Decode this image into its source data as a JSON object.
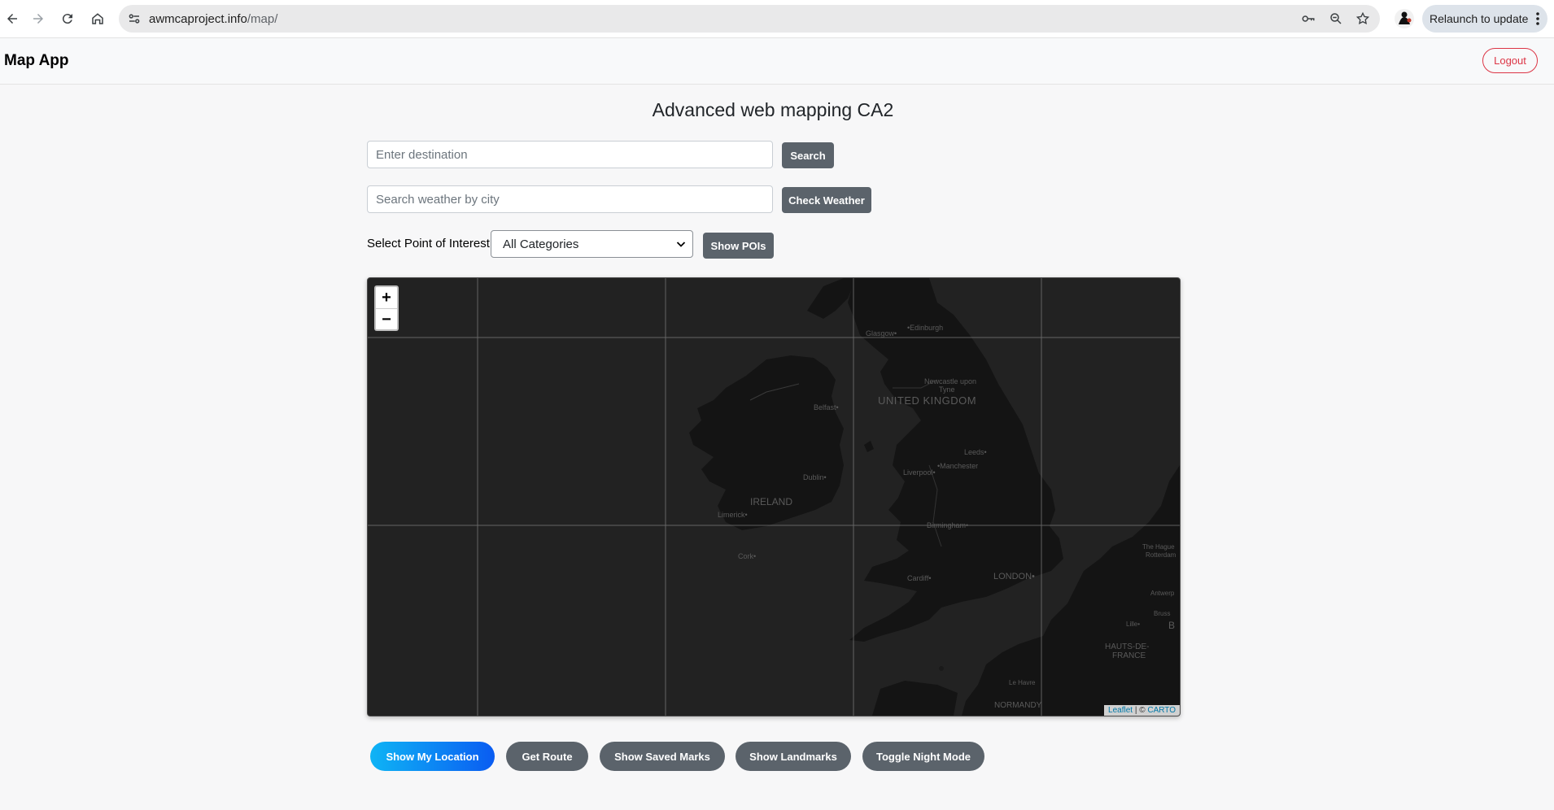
{
  "browser": {
    "url_host": "awmcaproject.info",
    "url_path": "/map/",
    "relaunch_label": "Relaunch to update"
  },
  "navbar": {
    "brand": "Map App",
    "logout_label": "Logout"
  },
  "main": {
    "title": "Advanced web mapping CA2",
    "destination_placeholder": "Enter destination",
    "search_label": "Search",
    "weather_placeholder": "Search weather by city",
    "check_weather_label": "Check Weather",
    "poi_label": "Select Point of Interest:",
    "poi_selected": "All Categories",
    "show_pois_label": "Show POIs"
  },
  "map": {
    "zoom_in": "+",
    "zoom_out": "−",
    "attribution_leaflet": "Leaflet",
    "attribution_sep": " | © ",
    "attribution_carto": "CARTO",
    "labels": {
      "glasgow": "Glasgow•",
      "edinburgh": "•Edinburgh",
      "united_kingdom": "UNITED KINGDOM",
      "newcastle": "Newcastle upon",
      "tyne": "Tyne",
      "belfast": "Belfast•",
      "leeds": "Leeds•",
      "manchester": "•Manchester",
      "liverpool": "Liverpool•",
      "dublin": "Dublin•",
      "ireland": "IRELAND",
      "limerick": "Limerick•",
      "birmingham": "Birmingham•",
      "cork": "Cork•",
      "cardiff": "Cardiff•",
      "london": "LONDON•",
      "the_hague": "The Hague",
      "rotterdam": "Rotterdam",
      "antwerp": "Antwerp",
      "brussels": "Bruss",
      "lille": "Lille•",
      "hauts_de_france_1": "HAUTS-DE-",
      "hauts_de_france_2": "FRANCE",
      "le_havre": "Le Havre",
      "normandy": "NORMANDY",
      "b": "B"
    }
  },
  "actions": {
    "show_location": "Show My Location",
    "get_route": "Get Route",
    "saved_marks": "Show Saved Marks",
    "landmarks": "Show Landmarks",
    "night_mode": "Toggle Night Mode"
  },
  "colors": {
    "primary_gradient_start": "#0fb4f5",
    "primary_gradient_end": "#0a5cf2",
    "secondary": "#5b636b",
    "danger": "#dc3545",
    "map_water": "#222222",
    "map_land": "#141414"
  }
}
